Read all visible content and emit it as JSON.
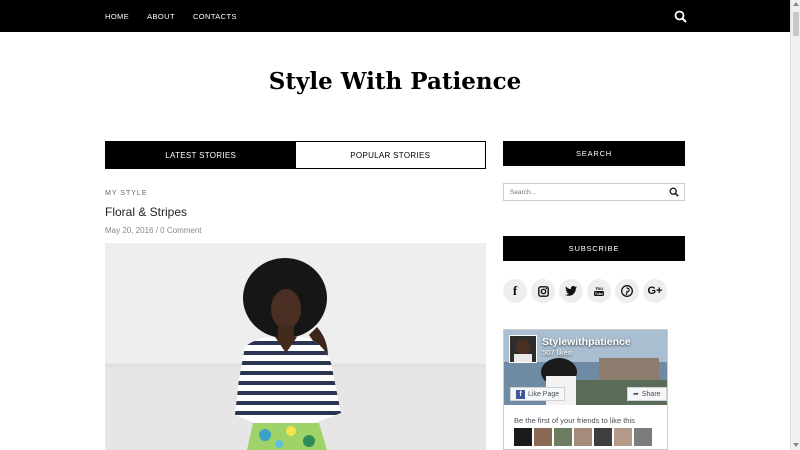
{
  "nav": {
    "items": [
      "HOME",
      "ABOUT",
      "CONTACTS"
    ]
  },
  "site": {
    "title": "Style With Patience"
  },
  "tabs": {
    "latest": "LATEST STORIES",
    "popular": "POPULAR STORIES"
  },
  "post": {
    "category": "MY STYLE",
    "title": "Floral & Stripes",
    "date": "May 20, 2016",
    "comments": "0 Comment"
  },
  "sidebar": {
    "search_header": "SEARCH",
    "search_placeholder": "Search...",
    "subscribe_header": "SUBSCRIBE",
    "social": [
      "f",
      "instagram",
      "twitter",
      "youtube",
      "pinterest",
      "G+"
    ]
  },
  "facebook": {
    "page_name": "Stylewithpatience",
    "likes": "507 likes",
    "like_label": "Like Page",
    "share_label": "Share",
    "friends_text": "Be the first of your friends to like this"
  },
  "colors": {
    "nav_bg": "#000000",
    "accent": "#000000",
    "social_bg": "#eeeeee"
  }
}
